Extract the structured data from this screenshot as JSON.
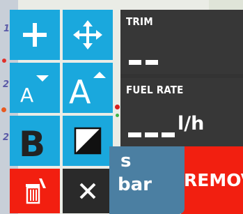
{
  "edit_menu": {
    "items": [
      {
        "name": "add",
        "icon": "plus-icon"
      },
      {
        "name": "move",
        "icon": "move-arrows-icon"
      },
      {
        "name": "decrease-font",
        "icon": "font-size-decrease-icon",
        "glyph": "A"
      },
      {
        "name": "increase-font",
        "icon": "font-size-increase-icon",
        "glyph": "A"
      },
      {
        "name": "bold",
        "icon": "bold-icon",
        "glyph": "B"
      },
      {
        "name": "contrast",
        "icon": "contrast-icon"
      },
      {
        "name": "delete",
        "icon": "trash-icon"
      },
      {
        "name": "close",
        "icon": "close-icon",
        "glyph": "✕"
      }
    ],
    "colors": {
      "blue": "#1aa8dd",
      "red": "#f21f10",
      "dark": "#2a2a2a"
    }
  },
  "instruments": {
    "trim": {
      "title": "TRIM",
      "value": ""
    },
    "fuel_rate": {
      "title": "FUEL RATE",
      "value": "",
      "unit": "l/h"
    }
  },
  "buttons": {
    "partial_left_line1": "s",
    "partial_left_line2": "bar",
    "remove": "REMOVE"
  },
  "map": {
    "labels": [
      "1",
      "2",
      "2"
    ]
  }
}
